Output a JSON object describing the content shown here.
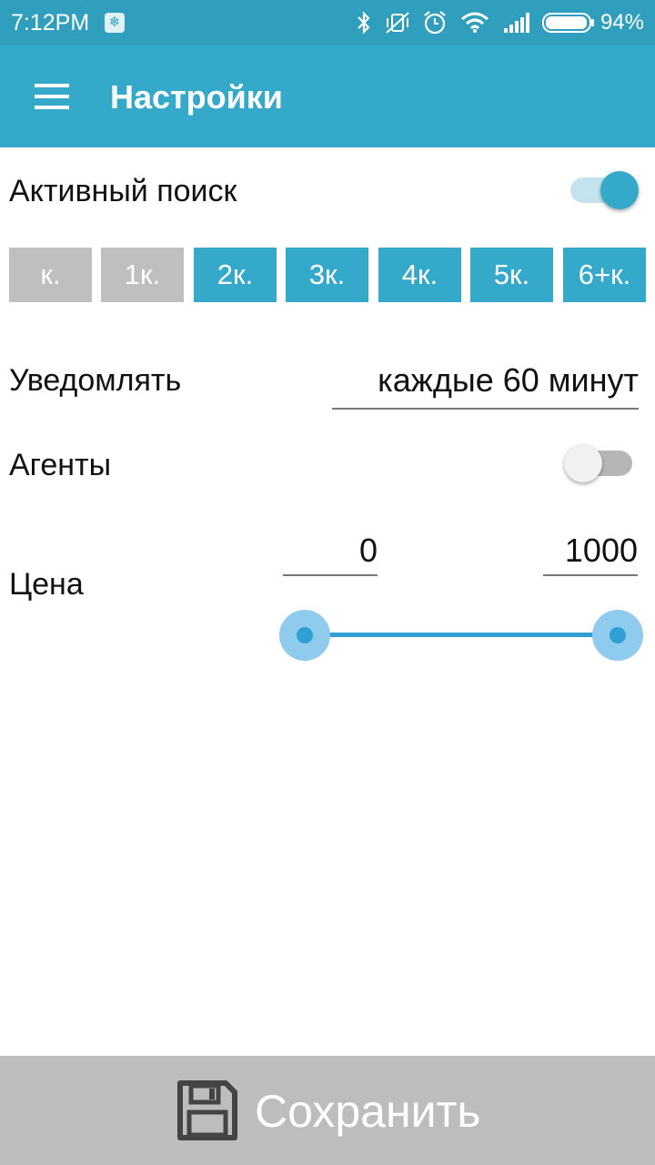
{
  "status_bar": {
    "time": "7:12PM",
    "battery": "94%",
    "icons": [
      "notification-icon",
      "bluetooth-icon",
      "vibrate-off-icon",
      "alarm-icon",
      "wifi-icon",
      "signal-icon",
      "battery-icon"
    ]
  },
  "app_bar": {
    "title": "Настройки",
    "menu_icon": "menu-icon"
  },
  "active_search": {
    "label": "Активный поиск",
    "enabled": true
  },
  "rooms": [
    {
      "label": "к.",
      "selected": false
    },
    {
      "label": "1к.",
      "selected": false
    },
    {
      "label": "2к.",
      "selected": true
    },
    {
      "label": "3к.",
      "selected": true
    },
    {
      "label": "4к.",
      "selected": true
    },
    {
      "label": "5к.",
      "selected": true
    },
    {
      "label": "6+к.",
      "selected": true
    }
  ],
  "notify": {
    "label": "Уведомлять",
    "value": "каждые 60 минут"
  },
  "agents": {
    "label": "Агенты",
    "enabled": false
  },
  "price": {
    "label": "Цена",
    "min": "0",
    "max": "1000",
    "range_start_fraction": 0,
    "range_end_fraction": 1
  },
  "save": {
    "label": "Сохранить",
    "icon": "floppy-disk-icon"
  },
  "colors": {
    "accent": "#35a9c9",
    "status_bar": "#2f9fbd",
    "inactive": "#bfbfbf",
    "slider": "#2f9fd6",
    "save_bar": "#bdbdbd"
  }
}
